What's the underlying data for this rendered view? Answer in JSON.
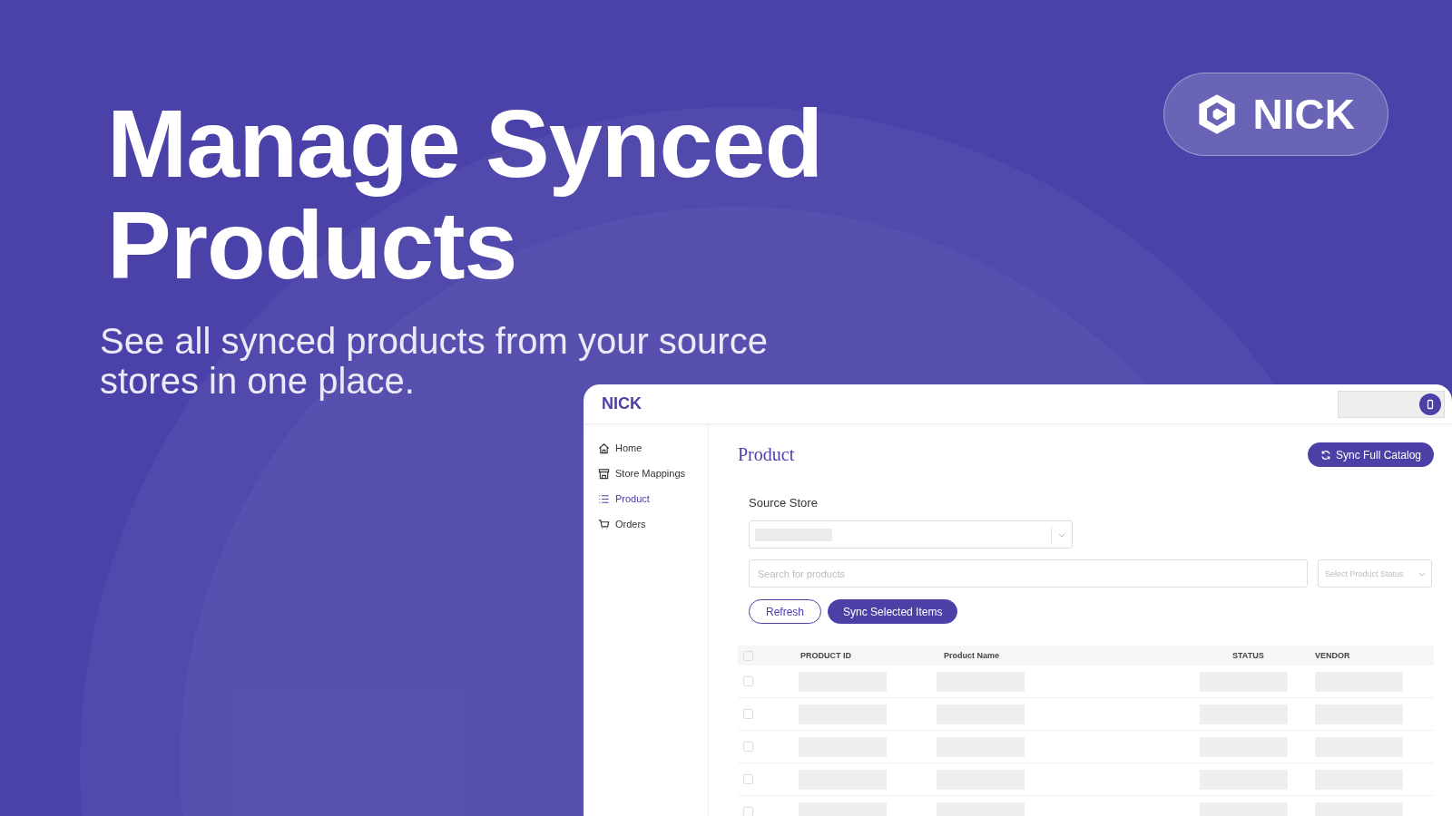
{
  "headline": "Manage Synced Products",
  "subtitle": "See all synced products from your source stores in one place.",
  "badge": {
    "label": "NICK"
  },
  "app": {
    "logo": "NICK",
    "sidebar": {
      "items": [
        {
          "label": "Home",
          "selected": false
        },
        {
          "label": "Store Mappings",
          "selected": false
        },
        {
          "label": "Product",
          "selected": true
        },
        {
          "label": "Orders",
          "selected": false
        }
      ]
    },
    "page_title": "Product",
    "sync_full_button": "Sync Full Catalog",
    "source_store": {
      "label": "Source Store"
    },
    "search": {
      "placeholder": "Search for products"
    },
    "status_select": {
      "placeholder": "Select Product Status"
    },
    "buttons": [
      {
        "label": "Refresh",
        "kind": "outline"
      },
      {
        "label": "Sync Selected Items",
        "kind": "filled"
      }
    ],
    "table": {
      "header_checked": false,
      "columns": [
        "PRODUCT ID",
        "Product Name",
        "STATUS",
        "VENDOR"
      ],
      "rows": [
        {
          "checked": false
        },
        {
          "checked": false
        },
        {
          "checked": false
        },
        {
          "checked": false
        },
        {
          "checked": false
        }
      ]
    }
  }
}
